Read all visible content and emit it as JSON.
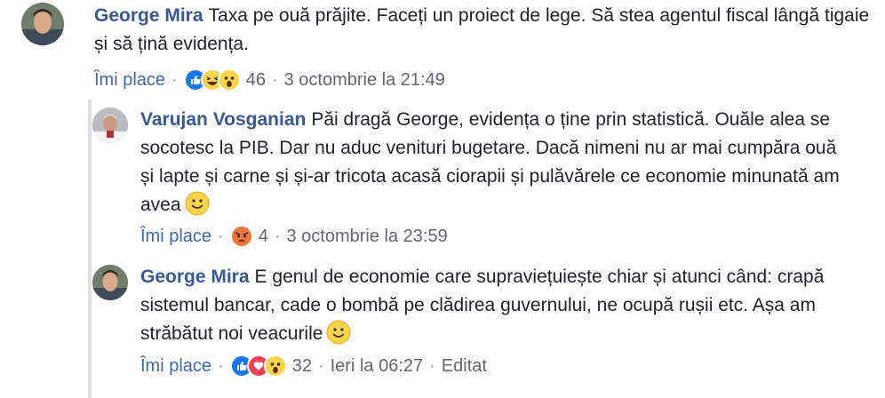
{
  "comments": [
    {
      "author": "George Mira",
      "text": "Taxa pe ouă prăjite. Faceți un proiect de lege. Să stea agentul fiscal lângă tigaie și să țină evidența.",
      "like_label": "Îmi place",
      "reactions": [
        "like",
        "haha",
        "wow"
      ],
      "reaction_count": "46",
      "timestamp": "3 octombrie la 21:49"
    },
    {
      "author": "Varujan Vosganian",
      "text": "Păi dragă George, evidența o ține prin statistică. Ouăle alea se socotesc la PIB. Dar nu aduc venituri bugetare. Dacă nimeni nu ar mai cumpăra ouă și lapte și carne și și-ar tricota acasă ciorapii și pulăvărele ce economie minunată am avea",
      "like_label": "Îmi place",
      "reactions": [
        "angry"
      ],
      "reaction_count": "4",
      "timestamp": "3 octombrie la 23:59"
    },
    {
      "author": "George Mira",
      "text": "E genul de economie care supraviețuiește chiar și atunci când: crapă sistemul bancar, cade o bombă pe clădirea guvernului, ne ocupă rușii etc. Așa am străbătut noi veacurile",
      "like_label": "Îmi place",
      "reactions": [
        "like",
        "love",
        "wow"
      ],
      "reaction_count": "32",
      "timestamp": "Ieri la 06:27",
      "edited_label": "Editat"
    }
  ],
  "separator": "·"
}
